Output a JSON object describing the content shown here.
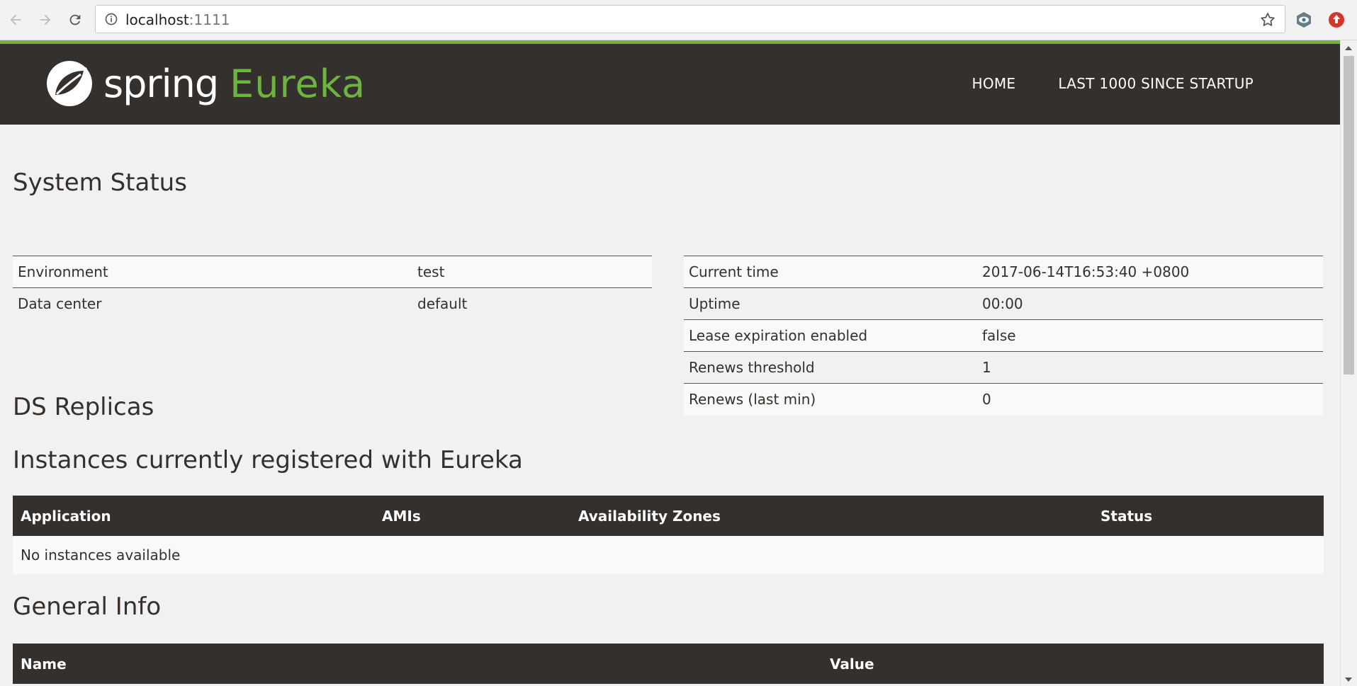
{
  "browser": {
    "url_host": "localhost",
    "url_port": ":1111",
    "icons": [
      "back-arrow-icon",
      "forward-arrow-icon",
      "reload-icon",
      "info-icon",
      "star-icon",
      "eye-extension-icon",
      "upload-extension-icon"
    ]
  },
  "colors": {
    "brand_dark": "#34302d",
    "brand_green": "#6db33f"
  },
  "navbar": {
    "logo_spring": "spring",
    "logo_eureka": "Eureka",
    "links": [
      "HOME",
      "LAST 1000 SINCE STARTUP"
    ]
  },
  "system_status": {
    "title": "System Status",
    "left": [
      {
        "key": "Environment",
        "value": "test"
      },
      {
        "key": "Data center",
        "value": "default"
      }
    ],
    "right": [
      {
        "key": "Current time",
        "value": "2017-06-14T16:53:40 +0800"
      },
      {
        "key": "Uptime",
        "value": "00:00"
      },
      {
        "key": "Lease expiration enabled",
        "value": "false"
      },
      {
        "key": "Renews threshold",
        "value": "1"
      },
      {
        "key": "Renews (last min)",
        "value": "0"
      }
    ]
  },
  "ds_replicas": {
    "title": "DS Replicas"
  },
  "instances": {
    "title": "Instances currently registered with Eureka",
    "headers": [
      "Application",
      "AMIs",
      "Availability Zones",
      "Status"
    ],
    "empty_message": "No instances available"
  },
  "general_info": {
    "title": "General Info",
    "headers": [
      "Name",
      "Value"
    ]
  }
}
